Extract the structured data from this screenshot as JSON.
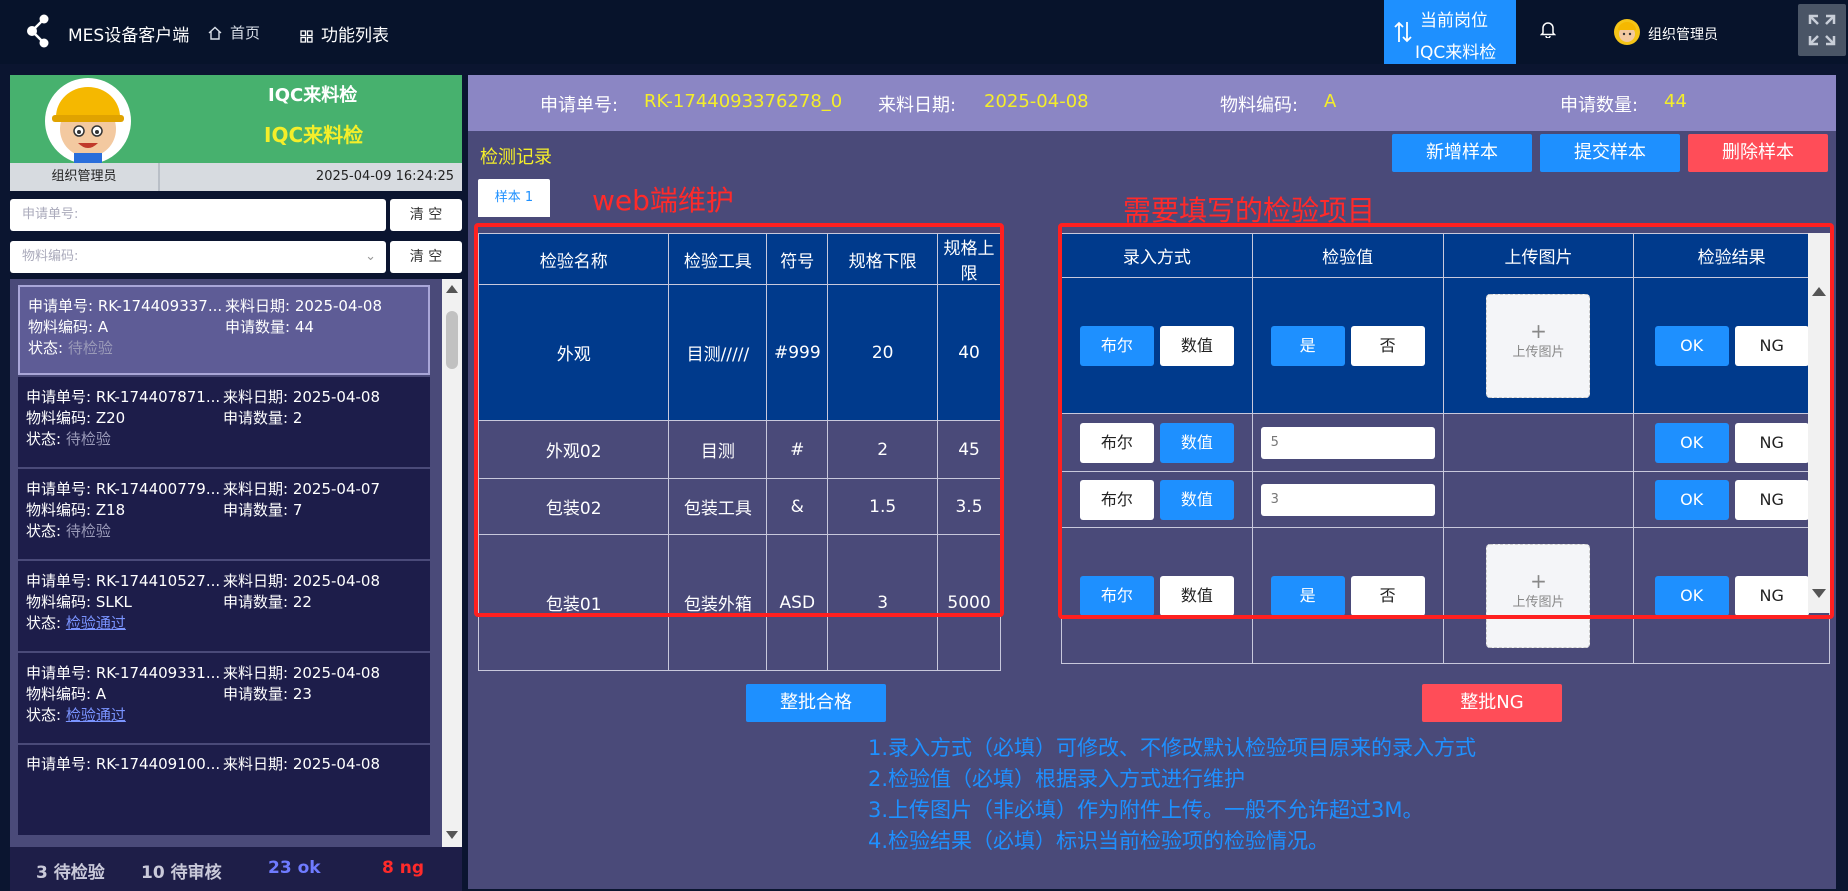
{
  "topbar": {
    "app_title": "MES设备客户端",
    "home": "首页",
    "func_list": "功能列表",
    "post_line1": "当前岗位",
    "post_line2": "IQC来料检",
    "user_name": "组织管理员",
    "icons": [
      "share-logo-icon",
      "home-icon",
      "grid-icon",
      "swap-arrows-icon",
      "bell-icon",
      "avatar-icon",
      "fullscreen-icon"
    ]
  },
  "profile": {
    "title1": "IQC来料检",
    "title2": "IQC来料检",
    "user": "组织管理员",
    "datetime": "2025-04-09 16:24:25",
    "colors": {
      "header_bg": "#47b16e",
      "title_yellow": "#f4ee2a"
    }
  },
  "filters": {
    "apply_no_placeholder": "申请单号:",
    "material_placeholder": "物料编码:",
    "clear_label": "清 空"
  },
  "list": {
    "items": [
      {
        "apply_label": "申请单号:",
        "apply_no": "RK-174409337...",
        "date_label": "来料日期:",
        "date": "2025-04-08",
        "mat_label": "物料编码:",
        "mat": "A",
        "qty_label": "申请数量:",
        "qty": "44",
        "status_label": "状态:",
        "status": "待检验"
      },
      {
        "apply_label": "申请单号:",
        "apply_no": "RK-174407871...",
        "date_label": "来料日期:",
        "date": "2025-04-08",
        "mat_label": "物料编码:",
        "mat": "Z20",
        "qty_label": "申请数量:",
        "qty": "2",
        "status_label": "状态:",
        "status": "待检验"
      },
      {
        "apply_label": "申请单号:",
        "apply_no": "RK-174400779...",
        "date_label": "来料日期:",
        "date": "2025-04-07",
        "mat_label": "物料编码:",
        "mat": "Z18",
        "qty_label": "申请数量:",
        "qty": "7",
        "status_label": "状态:",
        "status": "待检验"
      },
      {
        "apply_label": "申请单号:",
        "apply_no": "RK-174410527...",
        "date_label": "来料日期:",
        "date": "2025-04-08",
        "mat_label": "物料编码:",
        "mat": "SLKL",
        "qty_label": "申请数量:",
        "qty": "22",
        "status_label": "状态:",
        "status": "检验通过"
      },
      {
        "apply_label": "申请单号:",
        "apply_no": "RK-174409331...",
        "date_label": "来料日期:",
        "date": "2025-04-08",
        "mat_label": "物料编码:",
        "mat": "A",
        "qty_label": "申请数量:",
        "qty": "23",
        "status_label": "状态:",
        "status": "检验通过"
      },
      {
        "apply_label": "申请单号:",
        "apply_no": "RK-174409100...",
        "date_label": "来料日期:",
        "date": "2025-04-08"
      }
    ]
  },
  "counts": {
    "pending_check": "3 待检验",
    "pending_review": "10 待审核",
    "ok": "23 ok",
    "ng": "8 ng"
  },
  "info": {
    "apply_label": "申请单号:",
    "apply_no": "RK-1744093376278_0",
    "date_label": "来料日期:",
    "date": "2025-04-08",
    "mat_label": "物料编码:",
    "mat": "A",
    "qty_label": "申请数量:",
    "qty": "44"
  },
  "record": {
    "title": "检测记录",
    "add_sample": "新增样本",
    "submit_sample": "提交样本",
    "delete_sample": "删除样本",
    "tab": "样本 1"
  },
  "annotations": {
    "web": "web端维护",
    "need": "需要填写的检验项目",
    "notes": [
      "1.录入方式（必填）可修改、不修改默认检验项目原来的录入方式",
      "2.检验值（必填）根据录入方式进行维护",
      "3.上传图片（非必填）作为附件上传。一般不允许超过3M。",
      "4.检验结果（必填）标识当前检验项的检验情况。"
    ]
  },
  "left_table": {
    "headers": [
      "检验名称",
      "检验工具",
      "符号",
      "规格下限",
      "规格上限"
    ],
    "rows": [
      [
        "外观",
        "目测/////",
        "#999",
        "20",
        "40"
      ],
      [
        "外观02",
        "目测",
        "#",
        "2",
        "45"
      ],
      [
        "包装02",
        "包装工具",
        "&",
        "1.5",
        "3.5"
      ],
      [
        "包装01",
        "包装外箱",
        "ASD",
        "3",
        "5000"
      ]
    ]
  },
  "right_table": {
    "headers": [
      "录入方式",
      "检验值",
      "上传图片",
      "检验结果"
    ],
    "bool_label": "布尔",
    "numeric_label": "数值",
    "yes": "是",
    "no": "否",
    "upload": "上传图片",
    "upload_plus": "+",
    "ok": "OK",
    "ng": "NG",
    "row2_value": "5",
    "row3_value": "3"
  },
  "batch": {
    "pass": "整批合格",
    "ng": "整批NG"
  }
}
